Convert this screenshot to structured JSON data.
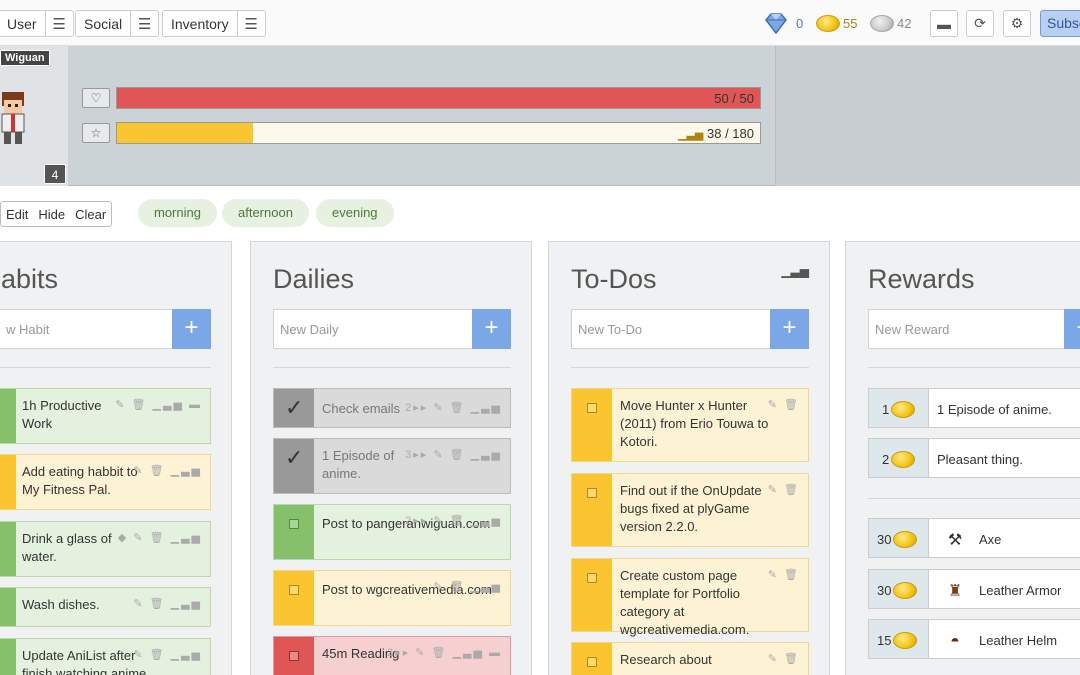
{
  "nav": {
    "menus": [
      {
        "label": "User"
      },
      {
        "label": "Social"
      },
      {
        "label": "Inventory"
      }
    ],
    "gems": "0",
    "gold": "55",
    "silver": "42",
    "subscribe_label": "Subsc"
  },
  "profile": {
    "username": "Wiguan",
    "level": "4",
    "health_text": "50 / 50",
    "health_fraction": 1.0,
    "exp_text": "38 / 180",
    "exp_fraction": 0.211
  },
  "filters": {
    "buttons": [
      "Edit",
      "Hide",
      "Clear"
    ],
    "tags": [
      "morning",
      "afternoon",
      "evening"
    ]
  },
  "habits": {
    "title": "abits",
    "placeholder": "w Habit",
    "items": [
      {
        "text": "1h Productive Work"
      },
      {
        "text": "Add eating habbit to My Fitness Pal."
      },
      {
        "text": "Drink a glass of water."
      },
      {
        "text": "Wash dishes."
      },
      {
        "text": "Update AniList after finish watching anime"
      }
    ]
  },
  "dailies": {
    "title": "Dailies",
    "placeholder": "New Daily",
    "items": [
      {
        "text": "Check emails",
        "streak": "2"
      },
      {
        "text": "1 Episode of anime.",
        "streak": "3"
      },
      {
        "text": "Post to pangeranwiguan.com",
        "streak": "2"
      },
      {
        "text": "Post to wgcreativemedia.com",
        "streak": ""
      },
      {
        "text": "45m Reading",
        "streak": "2"
      }
    ]
  },
  "todos": {
    "title": "To-Dos",
    "placeholder": "New To-Do",
    "items": [
      {
        "text": "Move Hunter x Hunter (2011) from Erio Touwa to Kotori."
      },
      {
        "text": "Find out if the OnUpdate bugs fixed at plyGame version 2.2.0."
      },
      {
        "text": "Create custom page template for Portfolio category at wgcreativemedia.com."
      },
      {
        "text": "Research about"
      }
    ]
  },
  "rewards": {
    "title": "Rewards",
    "placeholder": "New Reward",
    "custom": [
      {
        "price": "1",
        "text": "1 Episode of anime."
      },
      {
        "price": "2",
        "text": "Pleasant thing."
      }
    ],
    "gear": [
      {
        "price": "30",
        "text": "Axe",
        "icon": "axe-icon"
      },
      {
        "price": "30",
        "text": "Leather Armor",
        "icon": "armor-icon"
      },
      {
        "price": "15",
        "text": "Leather Helm",
        "icon": "helm-icon"
      }
    ]
  },
  "colors": {
    "health": "#e05656",
    "exp": "#fbc531",
    "add_button": "#7ba7e6"
  }
}
